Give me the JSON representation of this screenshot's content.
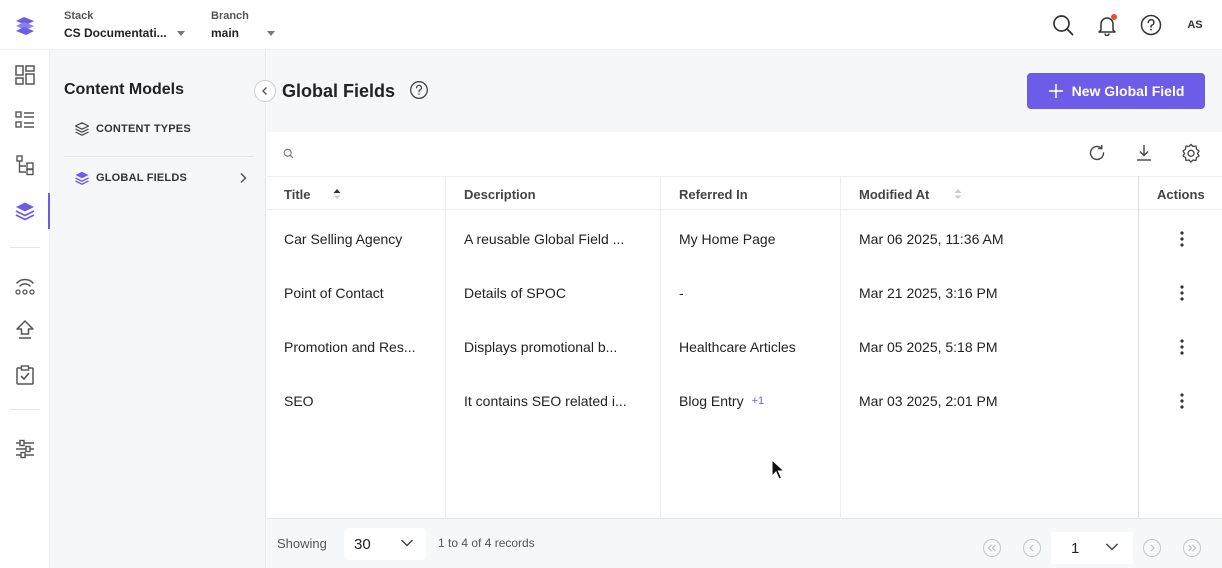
{
  "colors": {
    "accent": "#6c5ce7",
    "panel_bg": "#f6f7f9",
    "text": "#222222"
  },
  "header": {
    "logo_icon": "stack-logo-icon",
    "stack": {
      "label": "Stack",
      "value": "CS Documentati..."
    },
    "branch": {
      "label": "Branch",
      "value": "main"
    },
    "icons": [
      "search-icon",
      "bell-icon",
      "help-icon"
    ],
    "avatar_initials": "AS"
  },
  "rail": {
    "items": [
      "dashboard-icon",
      "entries-icon",
      "assets-icon",
      "content-models-icon",
      "releases-icon",
      "deploy-icon",
      "tasks-icon",
      "settings-icon"
    ],
    "active": "content-models-icon"
  },
  "subnav": {
    "title": "Content Models",
    "items": [
      {
        "label": "CONTENT TYPES",
        "icon": "layers-icon",
        "active": false
      },
      {
        "label": "GLOBAL FIELDS",
        "icon": "layers-icon",
        "active": true
      }
    ]
  },
  "main": {
    "title": "Global Fields",
    "new_button_label": "New Global Field",
    "search_placeholder": "",
    "toolbar_icons": [
      "refresh-icon",
      "download-icon",
      "settings-gear-icon"
    ]
  },
  "table": {
    "columns": [
      "Title",
      "Description",
      "Referred In",
      "Modified At",
      "Actions"
    ],
    "sorted_by": "Title",
    "rows": [
      {
        "title": "Car Selling Agency",
        "description": "A reusable Global Field ...",
        "referred_in": "My Home Page",
        "extra": "",
        "modified_at": "Mar 06 2025, 11:36 AM"
      },
      {
        "title": "Point of Contact",
        "description": "Details of SPOC",
        "referred_in": "-",
        "extra": "",
        "modified_at": "Mar 21 2025, 3:16 PM"
      },
      {
        "title": "Promotion and Res...",
        "description": "Displays promotional b...",
        "referred_in": "Healthcare Articles",
        "extra": "",
        "modified_at": "Mar 05 2025, 5:18 PM"
      },
      {
        "title": "SEO",
        "description": "It contains SEO related i...",
        "referred_in": "Blog Entry",
        "extra": "+1",
        "modified_at": "Mar 03 2025, 2:01 PM"
      }
    ]
  },
  "footer": {
    "showing_label": "Showing",
    "page_size": "30",
    "records_text": "1 to 4 of 4 records",
    "current_page": "1"
  }
}
